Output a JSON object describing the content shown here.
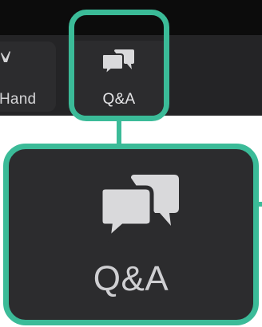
{
  "toolbar": {
    "raise_hand_label": "Hand",
    "qa_label": "Q&A"
  },
  "zoom_callout": {
    "qa_label": "Q&A"
  },
  "icons": {
    "raise_hand": "hand-icon",
    "qa": "speech-bubbles-icon"
  },
  "colors": {
    "highlight": "#3bbb98",
    "toolbar_background": "#242426",
    "button_background": "#2c2c2e",
    "icon_color": "#d9d9db"
  }
}
